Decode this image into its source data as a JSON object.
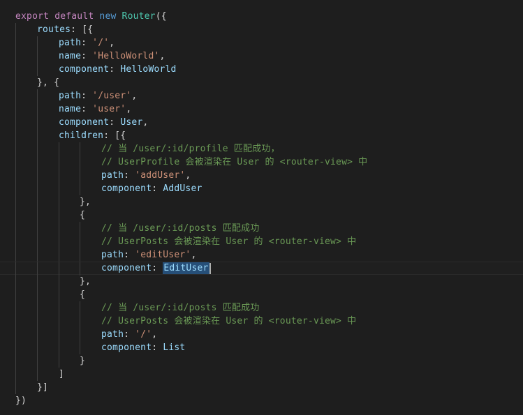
{
  "editor": {
    "lines": [
      {
        "indent": 0,
        "guides": [],
        "tokens": [
          {
            "t": "export",
            "c": "kw"
          },
          {
            "t": " ",
            "c": "pn"
          },
          {
            "t": "default",
            "c": "kw"
          },
          {
            "t": " ",
            "c": "pn"
          },
          {
            "t": "new",
            "c": "kw2"
          },
          {
            "t": " ",
            "c": "pn"
          },
          {
            "t": "Router",
            "c": "fn"
          },
          {
            "t": "({",
            "c": "pn"
          }
        ]
      },
      {
        "indent": 4,
        "guides": [
          0
        ],
        "tokens": [
          {
            "t": "routes",
            "c": "prop"
          },
          {
            "t": ": [{",
            "c": "pn"
          }
        ]
      },
      {
        "indent": 8,
        "guides": [
          0,
          4
        ],
        "tokens": [
          {
            "t": "path",
            "c": "prop"
          },
          {
            "t": ": ",
            "c": "pn"
          },
          {
            "t": "'/'",
            "c": "str"
          },
          {
            "t": ",",
            "c": "pn"
          }
        ]
      },
      {
        "indent": 8,
        "guides": [
          0,
          4
        ],
        "tokens": [
          {
            "t": "name",
            "c": "prop"
          },
          {
            "t": ": ",
            "c": "pn"
          },
          {
            "t": "'HelloWorld'",
            "c": "str"
          },
          {
            "t": ",",
            "c": "pn"
          }
        ]
      },
      {
        "indent": 8,
        "guides": [
          0,
          4
        ],
        "tokens": [
          {
            "t": "component",
            "c": "prop"
          },
          {
            "t": ": ",
            "c": "pn"
          },
          {
            "t": "HelloWorld",
            "c": "prop"
          }
        ]
      },
      {
        "indent": 4,
        "guides": [
          0
        ],
        "tokens": [
          {
            "t": "}, {",
            "c": "pn"
          }
        ]
      },
      {
        "indent": 8,
        "guides": [
          0,
          4
        ],
        "tokens": [
          {
            "t": "path",
            "c": "prop"
          },
          {
            "t": ": ",
            "c": "pn"
          },
          {
            "t": "'/user'",
            "c": "str"
          },
          {
            "t": ",",
            "c": "pn"
          }
        ]
      },
      {
        "indent": 8,
        "guides": [
          0,
          4
        ],
        "tokens": [
          {
            "t": "name",
            "c": "prop"
          },
          {
            "t": ": ",
            "c": "pn"
          },
          {
            "t": "'user'",
            "c": "str"
          },
          {
            "t": ",",
            "c": "pn"
          }
        ]
      },
      {
        "indent": 8,
        "guides": [
          0,
          4
        ],
        "tokens": [
          {
            "t": "component",
            "c": "prop"
          },
          {
            "t": ": ",
            "c": "pn"
          },
          {
            "t": "User",
            "c": "prop"
          },
          {
            "t": ",",
            "c": "pn"
          }
        ]
      },
      {
        "indent": 8,
        "guides": [
          0,
          4
        ],
        "tokens": [
          {
            "t": "children",
            "c": "prop"
          },
          {
            "t": ": [{",
            "c": "pn"
          }
        ]
      },
      {
        "indent": 16,
        "guides": [
          0,
          4,
          8,
          12
        ],
        "tokens": [
          {
            "t": "// 当 /user/:id/profile 匹配成功，",
            "c": "cm"
          }
        ]
      },
      {
        "indent": 16,
        "guides": [
          0,
          4,
          8,
          12
        ],
        "tokens": [
          {
            "t": "// UserProfile 会被渲染在 User 的 <router-view> 中",
            "c": "cm"
          }
        ]
      },
      {
        "indent": 16,
        "guides": [
          0,
          4,
          8,
          12
        ],
        "tokens": [
          {
            "t": "path",
            "c": "prop"
          },
          {
            "t": ": ",
            "c": "pn"
          },
          {
            "t": "'addUser'",
            "c": "str"
          },
          {
            "t": ",",
            "c": "pn"
          }
        ]
      },
      {
        "indent": 16,
        "guides": [
          0,
          4,
          8,
          12
        ],
        "tokens": [
          {
            "t": "component",
            "c": "prop"
          },
          {
            "t": ": ",
            "c": "pn"
          },
          {
            "t": "AddUser",
            "c": "prop"
          }
        ]
      },
      {
        "indent": 12,
        "guides": [
          0,
          4,
          8
        ],
        "tokens": [
          {
            "t": "},",
            "c": "pn"
          }
        ]
      },
      {
        "indent": 12,
        "guides": [
          0,
          4,
          8
        ],
        "tokens": [
          {
            "t": "{",
            "c": "pn"
          }
        ]
      },
      {
        "indent": 16,
        "guides": [
          0,
          4,
          8,
          12
        ],
        "tokens": [
          {
            "t": "// 当 /user/:id/posts 匹配成功",
            "c": "cm"
          }
        ]
      },
      {
        "indent": 16,
        "guides": [
          0,
          4,
          8,
          12
        ],
        "tokens": [
          {
            "t": "// UserPosts 会被渲染在 User 的 <router-view> 中",
            "c": "cm"
          }
        ]
      },
      {
        "indent": 16,
        "guides": [
          0,
          4,
          8,
          12
        ],
        "tokens": [
          {
            "t": "path",
            "c": "prop"
          },
          {
            "t": ": ",
            "c": "pn"
          },
          {
            "t": "'editUser'",
            "c": "str"
          },
          {
            "t": ",",
            "c": "pn"
          }
        ]
      },
      {
        "indent": 16,
        "guides": [
          0,
          4,
          8,
          12
        ],
        "current": true,
        "tokens": [
          {
            "t": "component",
            "c": "prop"
          },
          {
            "t": ": ",
            "c": "pn"
          },
          {
            "t": "EditUser",
            "c": "sel"
          }
        ]
      },
      {
        "indent": 12,
        "guides": [
          0,
          4,
          8
        ],
        "tokens": [
          {
            "t": "},",
            "c": "pn"
          }
        ]
      },
      {
        "indent": 12,
        "guides": [
          0,
          4,
          8
        ],
        "tokens": [
          {
            "t": "{",
            "c": "pn"
          }
        ]
      },
      {
        "indent": 16,
        "guides": [
          0,
          4,
          8,
          12
        ],
        "tokens": [
          {
            "t": "// 当 /user/:id/posts 匹配成功",
            "c": "cm"
          }
        ]
      },
      {
        "indent": 16,
        "guides": [
          0,
          4,
          8,
          12
        ],
        "tokens": [
          {
            "t": "// UserPosts 会被渲染在 User 的 <router-view> 中",
            "c": "cm"
          }
        ]
      },
      {
        "indent": 16,
        "guides": [
          0,
          4,
          8,
          12
        ],
        "tokens": [
          {
            "t": "path",
            "c": "prop"
          },
          {
            "t": ": ",
            "c": "pn"
          },
          {
            "t": "'/'",
            "c": "str"
          },
          {
            "t": ",",
            "c": "pn"
          }
        ]
      },
      {
        "indent": 16,
        "guides": [
          0,
          4,
          8,
          12
        ],
        "tokens": [
          {
            "t": "component",
            "c": "prop"
          },
          {
            "t": ": ",
            "c": "pn"
          },
          {
            "t": "List",
            "c": "prop"
          }
        ]
      },
      {
        "indent": 12,
        "guides": [
          0,
          4,
          8
        ],
        "tokens": [
          {
            "t": "}",
            "c": "pn"
          }
        ]
      },
      {
        "indent": 8,
        "guides": [
          0,
          4
        ],
        "tokens": [
          {
            "t": "]",
            "c": "pn"
          }
        ]
      },
      {
        "indent": 4,
        "guides": [
          0
        ],
        "tokens": [
          {
            "t": "}]",
            "c": "pn"
          }
        ]
      },
      {
        "indent": 0,
        "guides": [],
        "tokens": [
          {
            "t": "})",
            "c": "pn"
          }
        ]
      }
    ]
  }
}
